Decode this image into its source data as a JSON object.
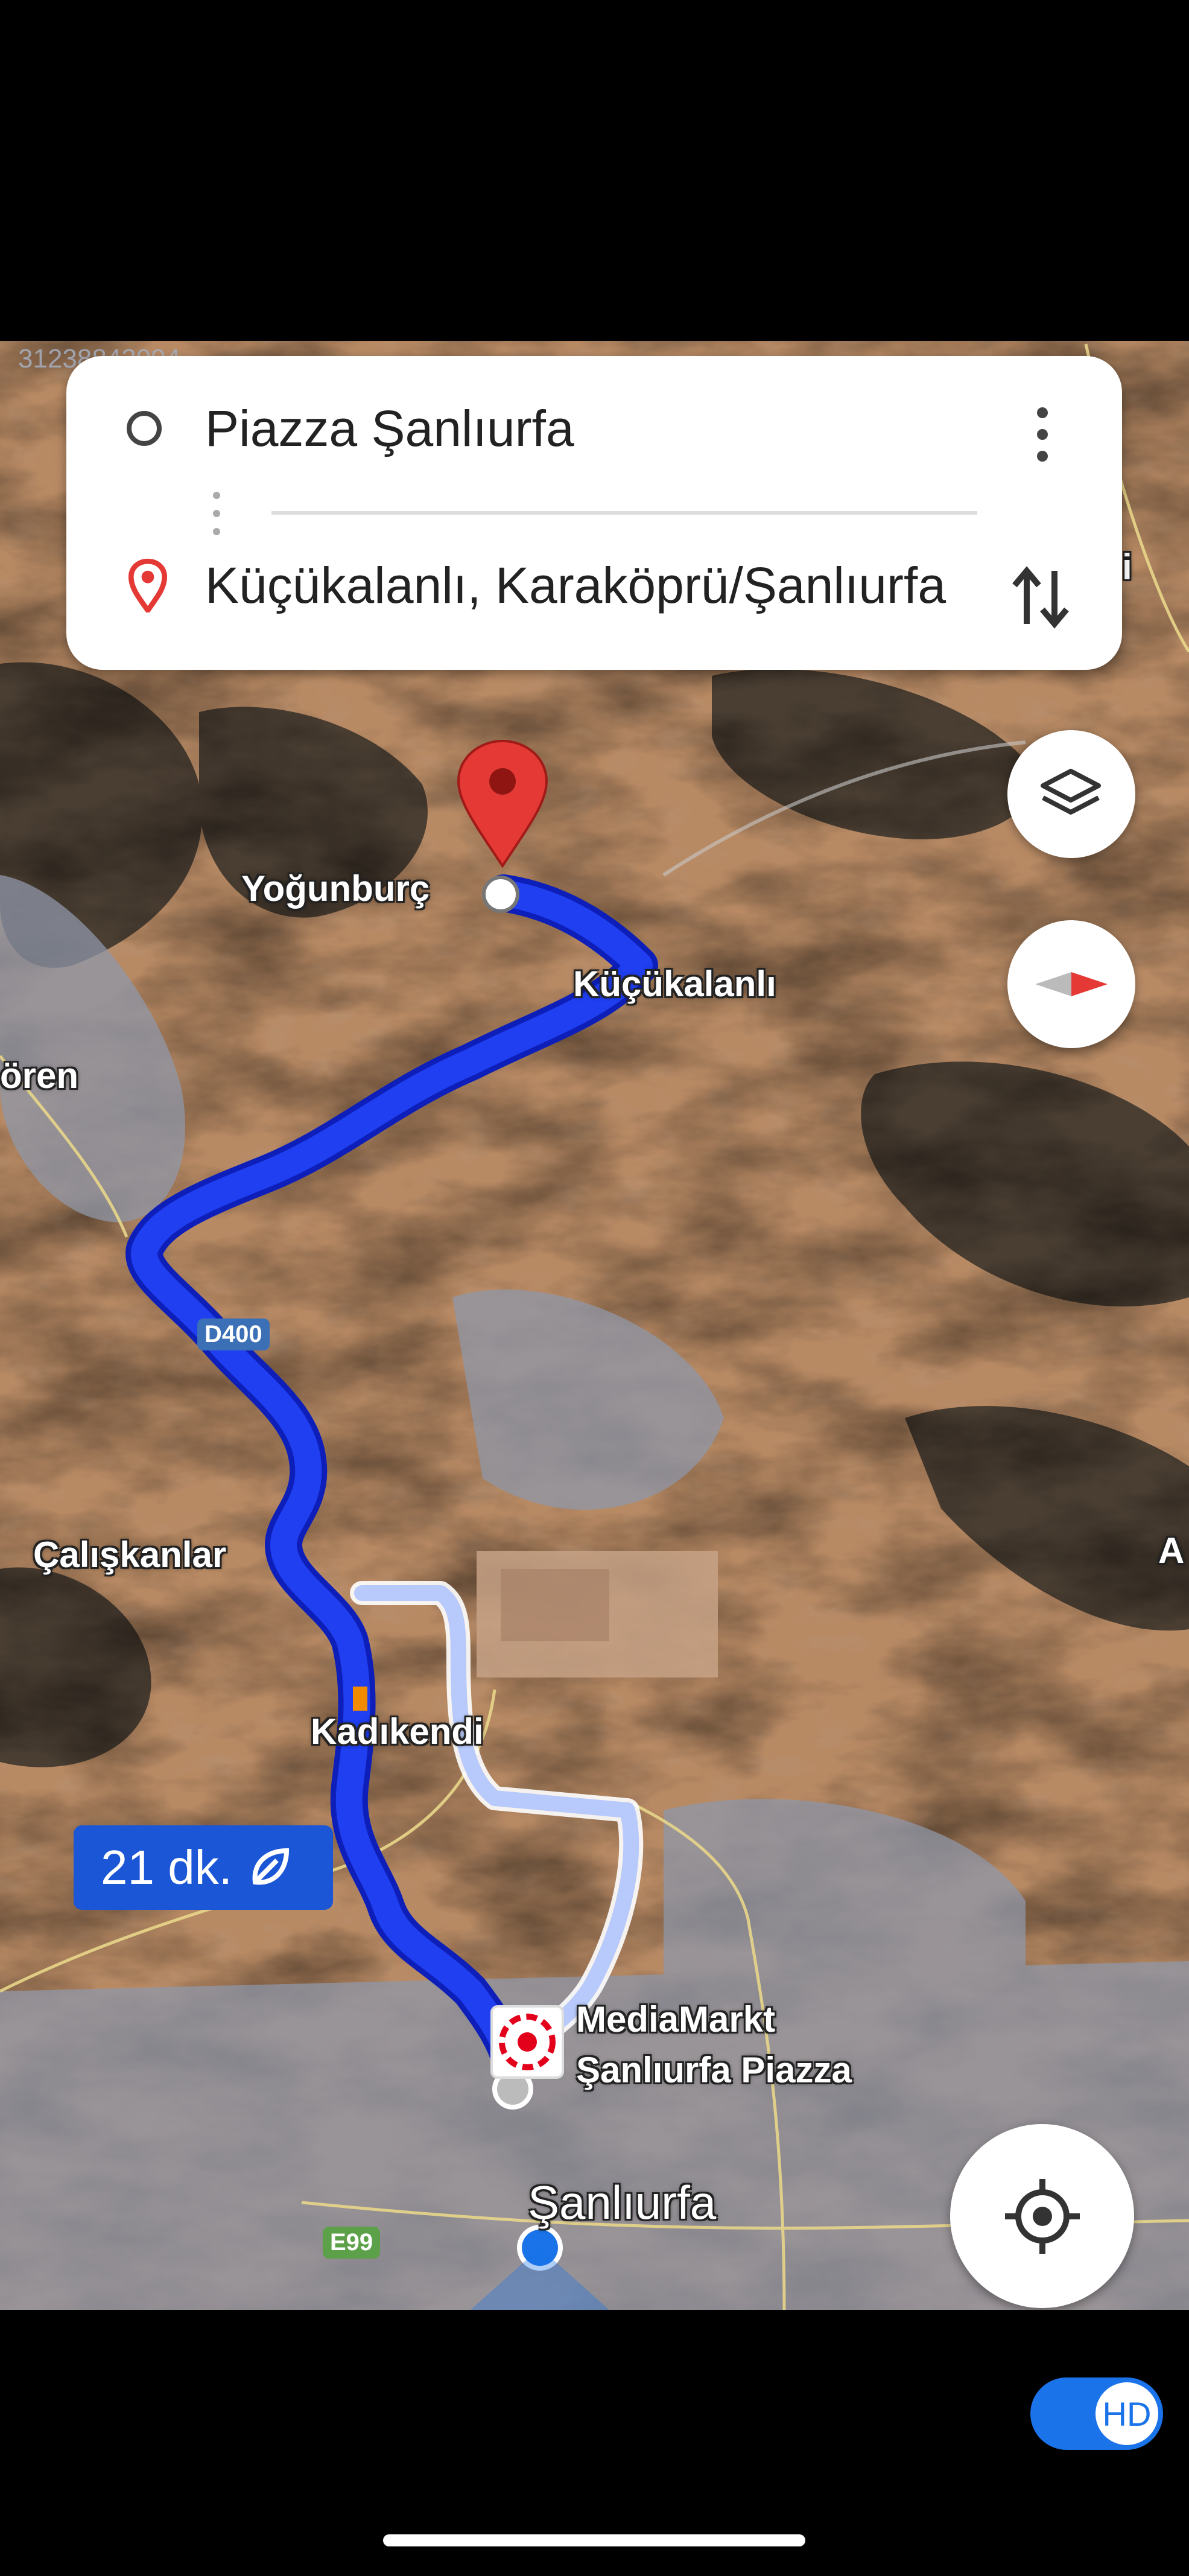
{
  "watermark_id": "31238842094",
  "directions": {
    "origin": "Piazza Şanlıurfa",
    "destination": "Küçükalanlı, Karaköprü/Şanlıurfa",
    "menu_icon": "more-vert-icon",
    "swap_icon": "swap-vertical-icon"
  },
  "map": {
    "labels": {
      "yogunburc": "Yoğunburç",
      "kucukalanli": "Küçükalanlı",
      "oren": "ören",
      "road_d400": "D400",
      "caliskanlar": "Çalışkanlar",
      "kadikendi": "Kadıkendi",
      "mediamarkt_line1": "MediaMarkt",
      "mediamarkt_line2": "Şanlıurfa Piazza",
      "sanliurfa": "Şanlıurfa",
      "road_e99": "E99",
      "edge_a": "A",
      "edge_i": "i"
    },
    "route_time": "21 dk.",
    "route_time_icon": "eco-leaf-icon",
    "colors": {
      "route_primary": "#1f3ff0",
      "route_alt": "#b8cafc",
      "pin": "#e53935"
    }
  },
  "controls": {
    "layers_icon": "layers-icon",
    "compass_icon": "compass-icon",
    "location_icon": "my-location-icon",
    "hd_label": "HD"
  }
}
